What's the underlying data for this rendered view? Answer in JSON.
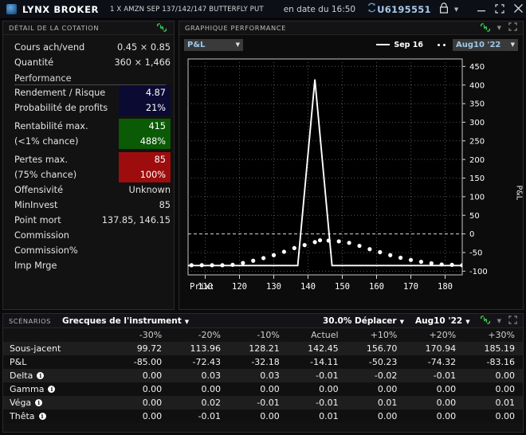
{
  "titlebar": {
    "brand": "LYNX BROKER",
    "contract": "1 X AMZN SEP 137/142/147 BUTTERFLY PUT",
    "date_text": "en date du 16:50",
    "refresh_icon": "refresh-icon",
    "account": "U6195551",
    "lock_icon": "lock-icon",
    "caret_icon": "chevron-down-icon",
    "minimize": "minimize-icon",
    "restore": "restore-icon",
    "close": "close-icon"
  },
  "quote_panel": {
    "header": "DÉTAIL DE LA COTATION",
    "link_icon": "link-icon",
    "rows": [
      {
        "label": "Cours ach/vend",
        "value": "0.45 × 0.85"
      },
      {
        "label": "Quantité",
        "value": "360 × 1,466"
      }
    ],
    "section_title": "Performance",
    "metrics": [
      {
        "label": "Rendement / Risque",
        "value": "4.87",
        "style": "navy"
      },
      {
        "label": "Probabilité de profits",
        "value": "21%",
        "style": "navy"
      },
      {
        "label": "Rentabilité max.",
        "value": "415",
        "style": "green"
      },
      {
        "label": "(<1% chance)",
        "value": "488%",
        "style": "green"
      },
      {
        "label": "Pertes max.",
        "value": "85",
        "style": "red"
      },
      {
        "label": "(75% chance)",
        "value": "100%",
        "style": "red"
      }
    ],
    "plain_rows": [
      {
        "label": "Offensivité",
        "value": "Unknown"
      },
      {
        "label": "MinInvest",
        "value": "85"
      },
      {
        "label": "Point mort",
        "value": "137.85, 146.15"
      },
      {
        "label": "Commission",
        "value": ""
      },
      {
        "label": "Commission%",
        "value": ""
      },
      {
        "label": "Imp Mrge",
        "value": ""
      }
    ]
  },
  "chart_panel": {
    "header": "GRAPHIQUE PERFORMANCE",
    "link_icon": "link-icon",
    "caret_icon": "chevron-down-icon",
    "expand_icon": "expand-icon",
    "metric_dropdown": "P&L",
    "legend_line_label": "Sep 16",
    "legend_dots_label": "Aug10 '22"
  },
  "chart_data": {
    "type": "line",
    "title": "P&L",
    "xlabel": "Prix:",
    "ylabel": "P&L",
    "xlim": [
      105,
      185
    ],
    "ylim": [
      -110,
      470
    ],
    "xticks": [
      110,
      120,
      130,
      140,
      150,
      160,
      170,
      180
    ],
    "yticks": [
      -100,
      -50,
      0,
      50,
      100,
      150,
      200,
      250,
      300,
      350,
      400,
      450
    ],
    "grid": true,
    "legend_position": "top-right",
    "series": [
      {
        "name": "Sep 16",
        "style": "solid-line",
        "color": "#ffffff",
        "points": [
          [
            105,
            -85
          ],
          [
            110,
            -85
          ],
          [
            115,
            -85
          ],
          [
            120,
            -85
          ],
          [
            125,
            -85
          ],
          [
            130,
            -85
          ],
          [
            135,
            -85
          ],
          [
            136.8,
            -85
          ],
          [
            137,
            -85
          ],
          [
            142,
            415
          ],
          [
            147,
            -85
          ],
          [
            147.2,
            -85
          ],
          [
            150,
            -85
          ],
          [
            155,
            -85
          ],
          [
            160,
            -85
          ],
          [
            165,
            -85
          ],
          [
            170,
            -85
          ],
          [
            175,
            -85
          ],
          [
            180,
            -85
          ],
          [
            185,
            -85
          ]
        ]
      },
      {
        "name": "Aug10 '22",
        "style": "dotted",
        "color": "#ffffff",
        "points": [
          [
            106,
            -84
          ],
          [
            109,
            -84
          ],
          [
            112,
            -84
          ],
          [
            115,
            -84
          ],
          [
            118,
            -83
          ],
          [
            121,
            -78
          ],
          [
            124,
            -72
          ],
          [
            127,
            -65
          ],
          [
            130,
            -57
          ],
          [
            133,
            -48
          ],
          [
            136,
            -38
          ],
          [
            139,
            -30
          ],
          [
            142,
            -22
          ],
          [
            143.5,
            -17
          ],
          [
            146,
            -18
          ],
          [
            149,
            -20
          ],
          [
            152,
            -24
          ],
          [
            155,
            -32
          ],
          [
            158,
            -41
          ],
          [
            161,
            -49
          ],
          [
            164,
            -57
          ],
          [
            167,
            -64
          ],
          [
            170,
            -70
          ],
          [
            173,
            -75
          ],
          [
            176,
            -79
          ],
          [
            179,
            -82
          ],
          [
            182,
            -83
          ],
          [
            185,
            -84
          ]
        ]
      }
    ]
  },
  "scenarios_panel": {
    "header": "SCÉNARIOS",
    "menu_label": "Grecques de l'instrument",
    "move_label": "30.0% Déplacer",
    "date_label": "Aug10 '22",
    "link_icon": "link-icon",
    "caret_icon": "chevron-down-icon",
    "expand_icon": "expand-icon",
    "columns": [
      "",
      "-30%",
      "-20%",
      "-10%",
      "Actuel",
      "+10%",
      "+20%",
      "+30%"
    ],
    "rows": [
      {
        "label": "Sous-jacent",
        "info": false,
        "values": [
          "99.72",
          "113.96",
          "128.21",
          "142.45",
          "156.70",
          "170.94",
          "185.19"
        ]
      },
      {
        "label": "P&L",
        "info": false,
        "values": [
          "-85.00",
          "-72.43",
          "-32.18",
          "-14.11",
          "-50.23",
          "-74.32",
          "-83.16"
        ]
      },
      {
        "label": "Delta",
        "info": true,
        "values": [
          "0.00",
          "0.03",
          "0.03",
          "-0.01",
          "-0.02",
          "-0.01",
          "0.00"
        ]
      },
      {
        "label": "Gamma",
        "info": true,
        "values": [
          "0.00",
          "0.00",
          "0.00",
          "0.00",
          "0.00",
          "0.00",
          "0.00"
        ]
      },
      {
        "label": "Véga",
        "info": true,
        "values": [
          "0.00",
          "0.02",
          "-0.01",
          "-0.01",
          "0.01",
          "0.00",
          "0.01"
        ]
      },
      {
        "label": "Thêta",
        "info": true,
        "values": [
          "0.00",
          "-0.01",
          "0.00",
          "0.01",
          "0.00",
          "0.00",
          "0.00"
        ]
      }
    ]
  },
  "colors": {
    "accent_blue": "#9fc8ea",
    "link_green": "#3ddd55",
    "navy_box": "#0a0a33",
    "green_box": "#0b5a06",
    "red_box": "#9d0d0d",
    "chart_line": "#ffffff",
    "background": "#000000"
  }
}
